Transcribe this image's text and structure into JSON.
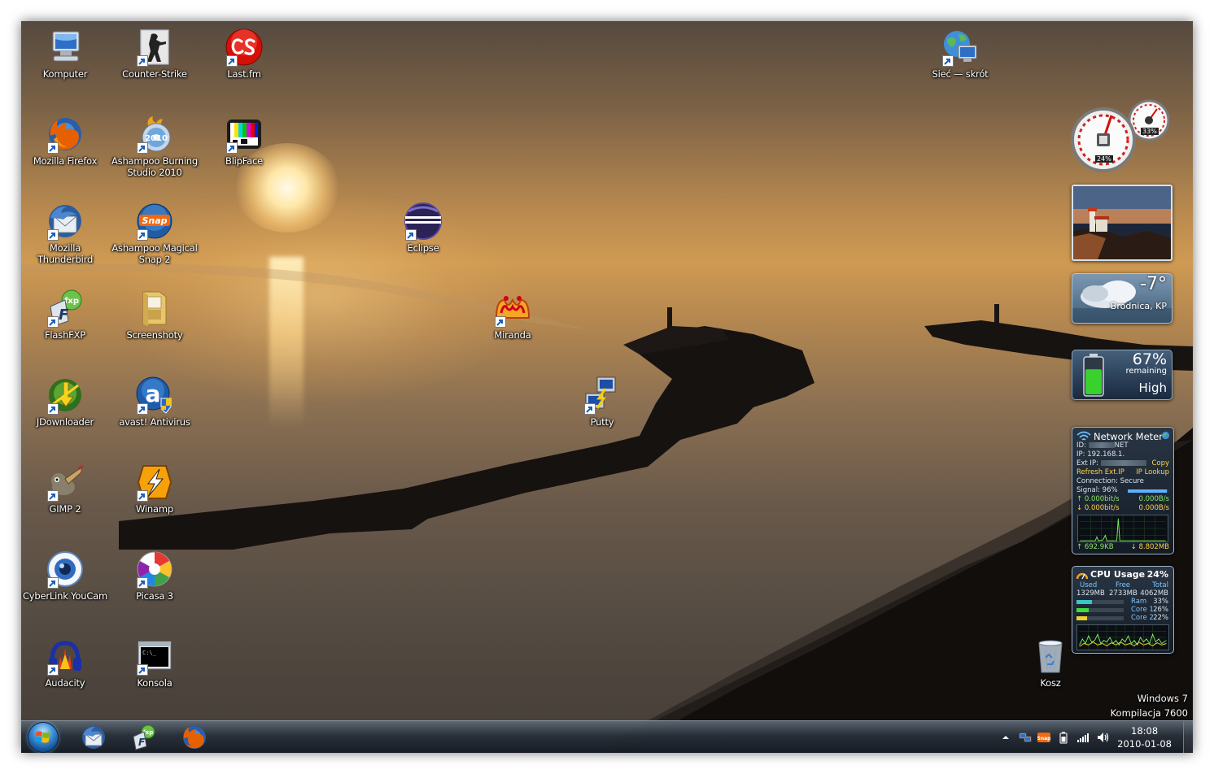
{
  "desktop_icons": [
    {
      "label": "Komputer",
      "icon": "computer-icon",
      "shortcut": false
    },
    {
      "label": "Counter-Strike",
      "icon": "counter-strike-icon",
      "shortcut": true
    },
    {
      "label": "Last.fm",
      "icon": "lastfm-icon",
      "shortcut": true
    },
    {
      "label": "Sieć — skrót",
      "icon": "network-globe-icon",
      "shortcut": true
    },
    {
      "label": "Mozilla Firefox",
      "icon": "firefox-icon",
      "shortcut": true
    },
    {
      "label": "Ashampoo Burning Studio 2010",
      "icon": "burning-studio-icon",
      "shortcut": true
    },
    {
      "label": "BlipFace",
      "icon": "blipface-icon",
      "shortcut": true
    },
    {
      "label": "Mozilla Thunderbird",
      "icon": "thunderbird-icon",
      "shortcut": true
    },
    {
      "label": "Ashampoo Magical Snap 2",
      "icon": "magical-snap-icon",
      "shortcut": true
    },
    {
      "label": "Eclipse",
      "icon": "eclipse-icon",
      "shortcut": true
    },
    {
      "label": "FlashFXP",
      "icon": "flashfxp-icon",
      "shortcut": true
    },
    {
      "label": "Screenshoty",
      "icon": "folder-icon",
      "shortcut": false
    },
    {
      "label": "Miranda",
      "icon": "miranda-icon",
      "shortcut": true
    },
    {
      "label": "JDownloader",
      "icon": "jdownloader-icon",
      "shortcut": true
    },
    {
      "label": "avast! Antivirus",
      "icon": "avast-icon",
      "shortcut": true
    },
    {
      "label": "Putty",
      "icon": "putty-icon",
      "shortcut": true
    },
    {
      "label": "GIMP 2",
      "icon": "gimp-icon",
      "shortcut": true
    },
    {
      "label": "Winamp",
      "icon": "winamp-icon",
      "shortcut": true
    },
    {
      "label": "CyberLink YouCam",
      "icon": "youcam-icon",
      "shortcut": true
    },
    {
      "label": "Picasa 3",
      "icon": "picasa-icon",
      "shortcut": true
    },
    {
      "label": "Audacity",
      "icon": "audacity-icon",
      "shortcut": true
    },
    {
      "label": "Konsola",
      "icon": "console-icon",
      "shortcut": true
    },
    {
      "label": "Kosz",
      "icon": "recycle-bin-icon",
      "shortcut": false
    }
  ],
  "gadgets": {
    "cpu_meter": {
      "cpu_percent": 24,
      "cpu_label": "24%",
      "memory_percent": 33,
      "memory_label": "33%"
    },
    "slideshow": {
      "icon": "lighthouse-photo"
    },
    "weather": {
      "temperature": "-7°",
      "location": "Brodnica, KP"
    },
    "battery": {
      "percent": 67,
      "percent_label": "67%",
      "remaining_label": "remaining",
      "level": "High"
    },
    "network_meter": {
      "title": "Network Meter",
      "id_label": "ID:",
      "id_value": "NET",
      "ip_label": "IP: 192.168.1.",
      "ext_ip_label": "Ext IP:",
      "copy_label": "Copy",
      "refresh_label": "Refresh Ext.IP",
      "lookup_label": "IP Lookup",
      "connection_label": "Connection: Secure",
      "signal_label": "Signal: 96%",
      "signal_percent": 96,
      "up_rate_bits": "0.000bit/s",
      "up_rate_bytes": "0.000B/s",
      "down_rate_bits": "0.000bit/s",
      "down_rate_bytes": "0.000B/s",
      "total_up": "692.9KB",
      "total_down": "8.802MB"
    },
    "cpu_usage": {
      "title": "CPU Usage",
      "percent_label": "24%",
      "used_label": "Used",
      "free_label": "Free",
      "total_label": "Total",
      "used_value": "1329MB",
      "free_value": "2733MB",
      "total_value": "4062MB",
      "ram_label": "Ram",
      "ram_percent_label": "33%",
      "ram_percent": 33,
      "core1_label": "Core 1",
      "core1_percent_label": "26%",
      "core1_percent": 26,
      "core2_label": "Core 2",
      "core2_percent_label": "22%",
      "core2_percent": 22
    }
  },
  "watermark": {
    "line1": "Windows 7",
    "line2": "Kompilacja 7600"
  },
  "taskbar": {
    "pinned": [
      {
        "name": "taskbar-thunderbird",
        "icon": "thunderbird-icon"
      },
      {
        "name": "taskbar-flashfxp",
        "icon": "flashfxp-icon"
      },
      {
        "name": "taskbar-firefox",
        "icon": "firefox-icon"
      }
    ],
    "tray": [
      "show-hidden-icons-arrow",
      "network-tray-icon",
      "snap-tray-icon",
      "battery-tray-icon",
      "signal-tray-icon",
      "volume-icon"
    ],
    "clock": {
      "time": "18:08",
      "date": "2010-01-08"
    }
  }
}
